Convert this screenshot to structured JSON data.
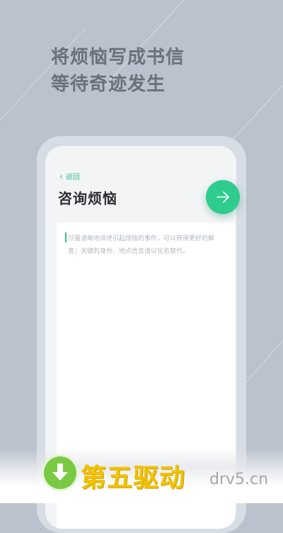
{
  "headline": {
    "line1": "将烦恼写成书信",
    "line2": "等待奇迹发生"
  },
  "screen": {
    "back_label": "返回",
    "title": "咨询烦恼",
    "placeholder": "尽量清晰地讲述引起烦恼的事件，可以获得更好的解答；关键的身份、地点信息请以化名替代。"
  },
  "icons": {
    "back": "chevron-left-icon",
    "next": "arrow-right-icon",
    "download": "download-arrow-icon"
  },
  "watermark": {
    "main": "第五驱动",
    "domain": "drv5.cn"
  },
  "colors": {
    "background": "#b9c2cd",
    "accent": "#2ecc8f",
    "headline": "#6a7179",
    "watermark_gold": "#f2c200",
    "watermark_green": "#7ac943"
  }
}
